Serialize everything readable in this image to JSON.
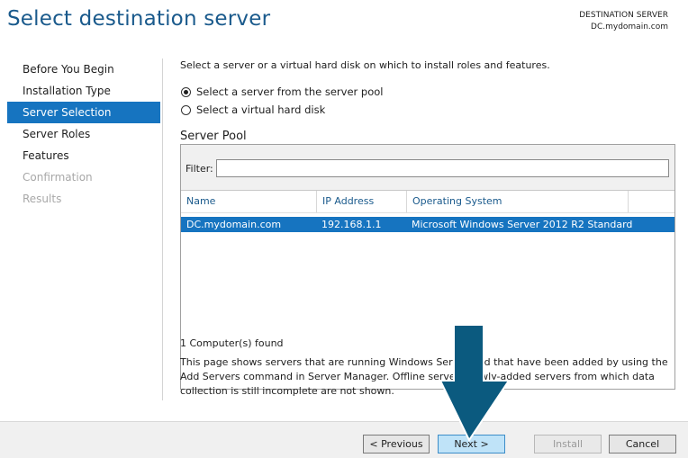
{
  "header": {
    "title": "Select destination server",
    "destination_label": "DESTINATION SERVER",
    "destination_value": "DC.mydomain.com"
  },
  "nav": {
    "items": [
      {
        "label": "Before You Begin",
        "state": "normal"
      },
      {
        "label": "Installation Type",
        "state": "normal"
      },
      {
        "label": "Server Selection",
        "state": "active"
      },
      {
        "label": "Server Roles",
        "state": "normal"
      },
      {
        "label": "Features",
        "state": "normal"
      },
      {
        "label": "Confirmation",
        "state": "disabled"
      },
      {
        "label": "Results",
        "state": "disabled"
      }
    ]
  },
  "main": {
    "description": "Select a server or a virtual hard disk on which to install roles and features.",
    "options": [
      {
        "label": "Select a server from the server pool",
        "checked": true
      },
      {
        "label": "Select a virtual hard disk",
        "checked": false
      }
    ],
    "pool_title": "Server Pool",
    "filter_label": "Filter:",
    "filter_value": "",
    "columns": [
      "Name",
      "IP Address",
      "Operating System"
    ],
    "rows": [
      {
        "name": "DC.mydomain.com",
        "ip": "192.168.1.1",
        "os": "Microsoft Windows Server 2012 R2 Standard",
        "selected": true
      }
    ],
    "found_text": "1 Computer(s) found",
    "info_line1": "This page shows servers that are running Windows Server and that have been added by using the",
    "info_line2": "Add Servers command in Server Manager. Offline servers newly-added servers from which data",
    "info_line3": "collection is still incomplete are not shown."
  },
  "footer": {
    "previous_label": "< Previous",
    "next_label": "Next >",
    "install_label": "Install",
    "cancel_label": "Cancel"
  },
  "colors": {
    "accent": "#1674c0",
    "title": "#1a5a8c",
    "arrow": "#0b5a7f"
  },
  "annotation": {
    "icon": "down-arrow-icon"
  }
}
